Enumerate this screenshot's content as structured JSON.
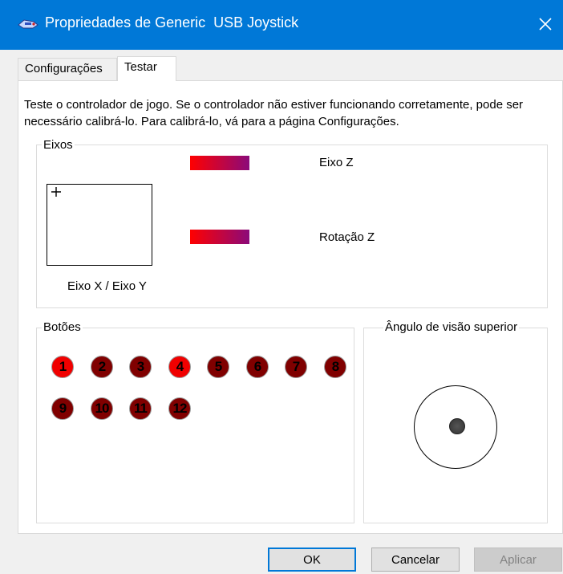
{
  "window": {
    "title": "Propriedades de Generic  USB Joystick",
    "title_icon": "joystick-icon",
    "close_icon": "close-icon",
    "accent_color": "#0078d7"
  },
  "tabs": [
    {
      "label": "Configurações",
      "active": false
    },
    {
      "label": "Testar",
      "active": true
    }
  ],
  "intro_text": "Teste o controlador de jogo. Se o controlador não estiver funcionando corretamente, pode ser necessário calibrá-lo. Para calibrá-lo, vá para a página Configurações.",
  "axes": {
    "label": "Eixos",
    "xy_label": "Eixo X / Eixo Y",
    "z_label": "Eixo Z",
    "rotation_z_label": "Rotação Z"
  },
  "buttons": {
    "label": "Botões",
    "items": [
      {
        "n": "1",
        "pressed": true
      },
      {
        "n": "2",
        "pressed": false
      },
      {
        "n": "3",
        "pressed": false
      },
      {
        "n": "4",
        "pressed": true
      },
      {
        "n": "5",
        "pressed": false
      },
      {
        "n": "6",
        "pressed": false
      },
      {
        "n": "7",
        "pressed": false
      },
      {
        "n": "8",
        "pressed": false
      },
      {
        "n": "9",
        "pressed": false
      },
      {
        "n": "10",
        "pressed": false
      },
      {
        "n": "11",
        "pressed": false
      },
      {
        "n": "12",
        "pressed": false
      }
    ],
    "pressed_color": "#f00000",
    "released_color": "#800000"
  },
  "pov": {
    "label": "Ângulo de visão superior"
  },
  "dialog_buttons": {
    "ok": "OK",
    "cancel": "Cancelar",
    "apply": "Aplicar"
  }
}
